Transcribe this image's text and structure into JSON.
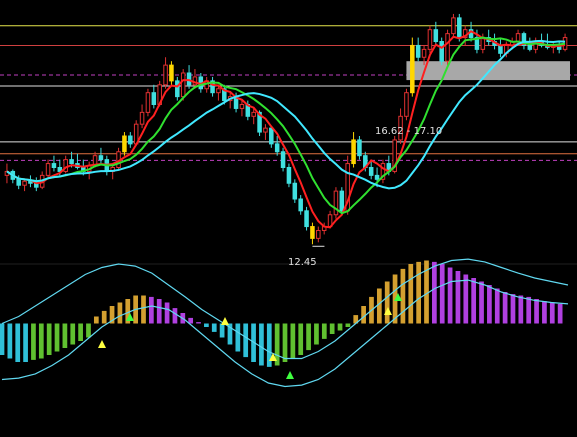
{
  "chart_data": {
    "type": "candlestick",
    "price_panel": {
      "ylim": [
        12.0,
        18.4
      ],
      "candles": [
        [
          14.2,
          14.5,
          14.0,
          14.3
        ],
        [
          14.3,
          14.35,
          14.0,
          14.1
        ],
        [
          14.1,
          14.2,
          13.85,
          13.95
        ],
        [
          13.95,
          14.1,
          13.8,
          14.05
        ],
        [
          14.05,
          14.2,
          13.9,
          14.0
        ],
        [
          14.0,
          14.15,
          13.8,
          13.9
        ],
        [
          13.9,
          14.3,
          13.85,
          14.2
        ],
        [
          14.2,
          14.6,
          14.1,
          14.5
        ],
        [
          14.5,
          14.7,
          14.3,
          14.4
        ],
        [
          14.4,
          14.6,
          14.2,
          14.3
        ],
        [
          14.3,
          14.7,
          14.25,
          14.6
        ],
        [
          14.6,
          14.8,
          14.4,
          14.5
        ],
        [
          14.5,
          14.75,
          14.35,
          14.4
        ],
        [
          14.4,
          14.6,
          14.2,
          14.3
        ],
        [
          14.3,
          14.55,
          14.1,
          14.45
        ],
        [
          14.45,
          14.8,
          14.4,
          14.7
        ],
        [
          14.7,
          14.9,
          14.5,
          14.6
        ],
        [
          14.6,
          14.7,
          14.2,
          14.3
        ],
        [
          14.3,
          14.5,
          14.1,
          14.4
        ],
        [
          14.4,
          14.9,
          14.35,
          14.8
        ],
        [
          14.8,
          15.3,
          14.7,
          15.2
        ],
        [
          15.2,
          15.3,
          14.9,
          15.0
        ],
        [
          15.0,
          15.6,
          14.95,
          15.5
        ],
        [
          15.5,
          16.0,
          15.4,
          15.8
        ],
        [
          15.8,
          16.4,
          15.7,
          16.3
        ],
        [
          16.3,
          16.5,
          15.9,
          16.0
        ],
        [
          16.0,
          16.6,
          15.95,
          16.5
        ],
        [
          16.5,
          17.2,
          16.4,
          17.0
        ],
        [
          17.0,
          17.1,
          16.5,
          16.6
        ],
        [
          16.6,
          16.7,
          16.1,
          16.2
        ],
        [
          16.2,
          16.9,
          16.1,
          16.8
        ],
        [
          16.8,
          17.0,
          16.4,
          16.5
        ],
        [
          16.5,
          16.9,
          16.4,
          16.7
        ],
        [
          16.7,
          16.8,
          16.3,
          16.4
        ],
        [
          16.4,
          16.7,
          16.3,
          16.6
        ],
        [
          16.6,
          16.7,
          16.2,
          16.3
        ],
        [
          16.3,
          16.5,
          16.1,
          16.4
        ],
        [
          16.4,
          16.5,
          16.0,
          16.1
        ],
        [
          16.1,
          16.3,
          15.9,
          16.2
        ],
        [
          16.2,
          16.3,
          15.8,
          15.9
        ],
        [
          15.9,
          16.1,
          15.7,
          16.0
        ],
        [
          16.0,
          16.1,
          15.6,
          15.7
        ],
        [
          15.7,
          15.9,
          15.5,
          15.8
        ],
        [
          15.8,
          15.85,
          15.2,
          15.3
        ],
        [
          15.3,
          15.5,
          15.1,
          15.4
        ],
        [
          15.4,
          15.45,
          14.9,
          15.0
        ],
        [
          15.0,
          15.2,
          14.7,
          14.8
        ],
        [
          14.8,
          14.9,
          14.3,
          14.4
        ],
        [
          14.4,
          14.5,
          13.9,
          14.0
        ],
        [
          14.0,
          14.1,
          13.5,
          13.6
        ],
        [
          13.6,
          13.7,
          13.2,
          13.3
        ],
        [
          13.3,
          13.4,
          12.8,
          12.9
        ],
        [
          12.9,
          13.0,
          12.45,
          12.6
        ],
        [
          12.6,
          12.9,
          12.5,
          12.8
        ],
        [
          12.8,
          13.0,
          12.7,
          12.9
        ],
        [
          12.9,
          13.3,
          12.85,
          13.2
        ],
        [
          13.2,
          13.9,
          13.1,
          13.8
        ],
        [
          13.8,
          13.9,
          13.2,
          13.3
        ],
        [
          13.3,
          14.7,
          13.2,
          14.5
        ],
        [
          14.5,
          15.3,
          14.4,
          15.1
        ],
        [
          15.1,
          15.2,
          14.6,
          14.7
        ],
        [
          14.7,
          14.8,
          14.3,
          14.4
        ],
        [
          14.4,
          14.6,
          14.1,
          14.2
        ],
        [
          14.2,
          14.4,
          13.9,
          14.1
        ],
        [
          14.1,
          14.6,
          14.0,
          14.5
        ],
        [
          14.5,
          14.7,
          14.2,
          14.3
        ],
        [
          14.3,
          15.2,
          14.25,
          15.1
        ],
        [
          15.1,
          15.9,
          15.0,
          15.7
        ],
        [
          15.7,
          16.4,
          15.6,
          16.3
        ],
        [
          16.3,
          17.7,
          16.2,
          17.5
        ],
        [
          17.5,
          17.7,
          17.1,
          17.2
        ],
        [
          17.2,
          17.5,
          17.0,
          17.4
        ],
        [
          17.4,
          18.0,
          17.3,
          17.9
        ],
        [
          17.9,
          18.1,
          17.5,
          17.6
        ],
        [
          17.6,
          17.7,
          17.0,
          17.1
        ],
        [
          17.1,
          17.9,
          17.0,
          17.8
        ],
        [
          17.8,
          18.3,
          17.7,
          18.2
        ],
        [
          18.2,
          18.3,
          17.6,
          17.7
        ],
        [
          17.7,
          18.0,
          17.5,
          17.9
        ],
        [
          17.9,
          18.1,
          17.6,
          17.7
        ],
        [
          17.7,
          17.9,
          17.3,
          17.4
        ],
        [
          17.4,
          17.8,
          17.3,
          17.7
        ],
        [
          17.7,
          17.9,
          17.5,
          17.6
        ],
        [
          17.6,
          17.8,
          17.4,
          17.5
        ],
        [
          17.5,
          17.7,
          17.2,
          17.3
        ],
        [
          17.3,
          17.6,
          17.2,
          17.5
        ],
        [
          17.5,
          17.7,
          17.4,
          17.6
        ],
        [
          17.6,
          17.9,
          17.5,
          17.8
        ],
        [
          17.8,
          17.85,
          17.4,
          17.5
        ],
        [
          17.5,
          17.7,
          17.35,
          17.4
        ],
        [
          17.4,
          17.7,
          17.3,
          17.6
        ],
        [
          17.6,
          17.8,
          17.45,
          17.5
        ],
        [
          17.5,
          17.8,
          17.4,
          17.45
        ],
        [
          17.45,
          17.6,
          17.3,
          17.5
        ],
        [
          17.5,
          17.6,
          17.3,
          17.4
        ],
        [
          17.4,
          17.8,
          17.35,
          17.7
        ]
      ],
      "highlight_indices": [
        20,
        28,
        52,
        59,
        69,
        96
      ],
      "horizontal_lines": [
        {
          "value": 18.0,
          "color": "#e6e64c",
          "style": "solid"
        },
        {
          "value": 17.5,
          "color": "#d04040",
          "style": "solid"
        },
        {
          "value": 16.75,
          "color": "#c040c0",
          "style": "dashed"
        },
        {
          "value": 16.47,
          "color": "#e0e0e0",
          "style": "solid"
        },
        {
          "value": 15.05,
          "color": "#e0e0e0",
          "style": "solid"
        },
        {
          "value": 14.75,
          "color": "#e07040",
          "style": "solid"
        },
        {
          "value": 14.58,
          "color": "#c040c0",
          "style": "dashed"
        }
      ],
      "price_band": {
        "low": 16.62,
        "high": 17.1,
        "label": "16.62 - 17.10",
        "start_index": 69
      },
      "low_marker": {
        "index": 52,
        "value": 12.45,
        "label": "12.45"
      }
    },
    "indicator_panel": {
      "ylim": [
        -1.0,
        1.0
      ],
      "histogram": [
        -0.45,
        -0.5,
        -0.55,
        -0.55,
        -0.52,
        -0.5,
        -0.45,
        -0.4,
        -0.35,
        -0.3,
        -0.25,
        -0.2,
        0.1,
        0.18,
        0.25,
        0.3,
        0.35,
        0.4,
        0.4,
        0.38,
        0.35,
        0.3,
        0.22,
        0.15,
        0.08,
        0.02,
        -0.05,
        -0.12,
        -0.2,
        -0.3,
        -0.4,
        -0.48,
        -0.55,
        -0.6,
        -0.62,
        -0.6,
        -0.55,
        -0.5,
        -0.45,
        -0.38,
        -0.3,
        -0.22,
        -0.15,
        -0.1,
        -0.05,
        0.12,
        0.25,
        0.38,
        0.5,
        0.6,
        0.7,
        0.78,
        0.85,
        0.88,
        0.9,
        0.88,
        0.85,
        0.8,
        0.75,
        0.7,
        0.65,
        0.6,
        0.55,
        0.5,
        0.45,
        0.42,
        0.4,
        0.38,
        0.35,
        0.32,
        0.3,
        0.28
      ],
      "upper_curve": [
        0.0,
        0.1,
        0.25,
        0.4,
        0.55,
        0.7,
        0.8,
        0.85,
        0.82,
        0.72,
        0.55,
        0.38,
        0.2,
        0.05,
        -0.1,
        -0.25,
        -0.4,
        -0.5,
        -0.5,
        -0.4,
        -0.25,
        -0.05,
        0.15,
        0.35,
        0.55,
        0.7,
        0.82,
        0.9,
        0.92,
        0.88,
        0.8,
        0.72,
        0.65,
        0.6,
        0.55
      ],
      "lower_curve": [
        -0.8,
        -0.78,
        -0.72,
        -0.6,
        -0.45,
        -0.25,
        -0.05,
        0.1,
        0.2,
        0.25,
        0.2,
        0.05,
        -0.15,
        -0.35,
        -0.55,
        -0.72,
        -0.85,
        -0.9,
        -0.88,
        -0.8,
        -0.65,
        -0.45,
        -0.25,
        -0.05,
        0.15,
        0.35,
        0.5,
        0.6,
        0.62,
        0.55,
        0.45,
        0.38,
        0.33,
        0.3,
        0.28
      ]
    }
  },
  "labels": {
    "band": "16.62 - 17.10",
    "low": "12.45"
  }
}
